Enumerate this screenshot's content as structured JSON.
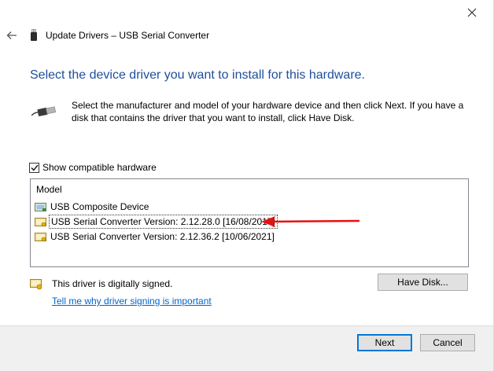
{
  "window": {
    "title": "Update Drivers – USB Serial Converter",
    "close_icon": "close-icon",
    "back_icon": "back-arrow-icon"
  },
  "heading": "Select the device driver you want to install for this hardware.",
  "description": "Select the manufacturer and model of your hardware device and then click Next. If you have a disk that contains the driver that you want to install, click Have Disk.",
  "compatible": {
    "label": "Show compatible hardware",
    "checked": true
  },
  "model_list": {
    "header": "Model",
    "items": [
      {
        "label": "USB Composite Device",
        "icon": "device-icon",
        "selected": false
      },
      {
        "label": "USB Serial Converter Version: 2.12.28.0 [16/08/2017]",
        "icon": "signed-driver-icon",
        "selected": true
      },
      {
        "label": "USB Serial Converter Version: 2.12.36.2 [10/06/2021]",
        "icon": "signed-driver-icon",
        "selected": false
      }
    ]
  },
  "annotation": {
    "arrow_color": "#e81010",
    "icon": "red-arrow-icon"
  },
  "signing": {
    "status": "This driver is digitally signed.",
    "link": "Tell me why driver signing is important"
  },
  "buttons": {
    "have_disk": "Have Disk...",
    "next": "Next",
    "cancel": "Cancel"
  },
  "colors": {
    "heading": "#1f4e9c",
    "link": "#0066cc",
    "footer_bg": "#f0f0f0",
    "default_button_border": "#0078d7"
  }
}
